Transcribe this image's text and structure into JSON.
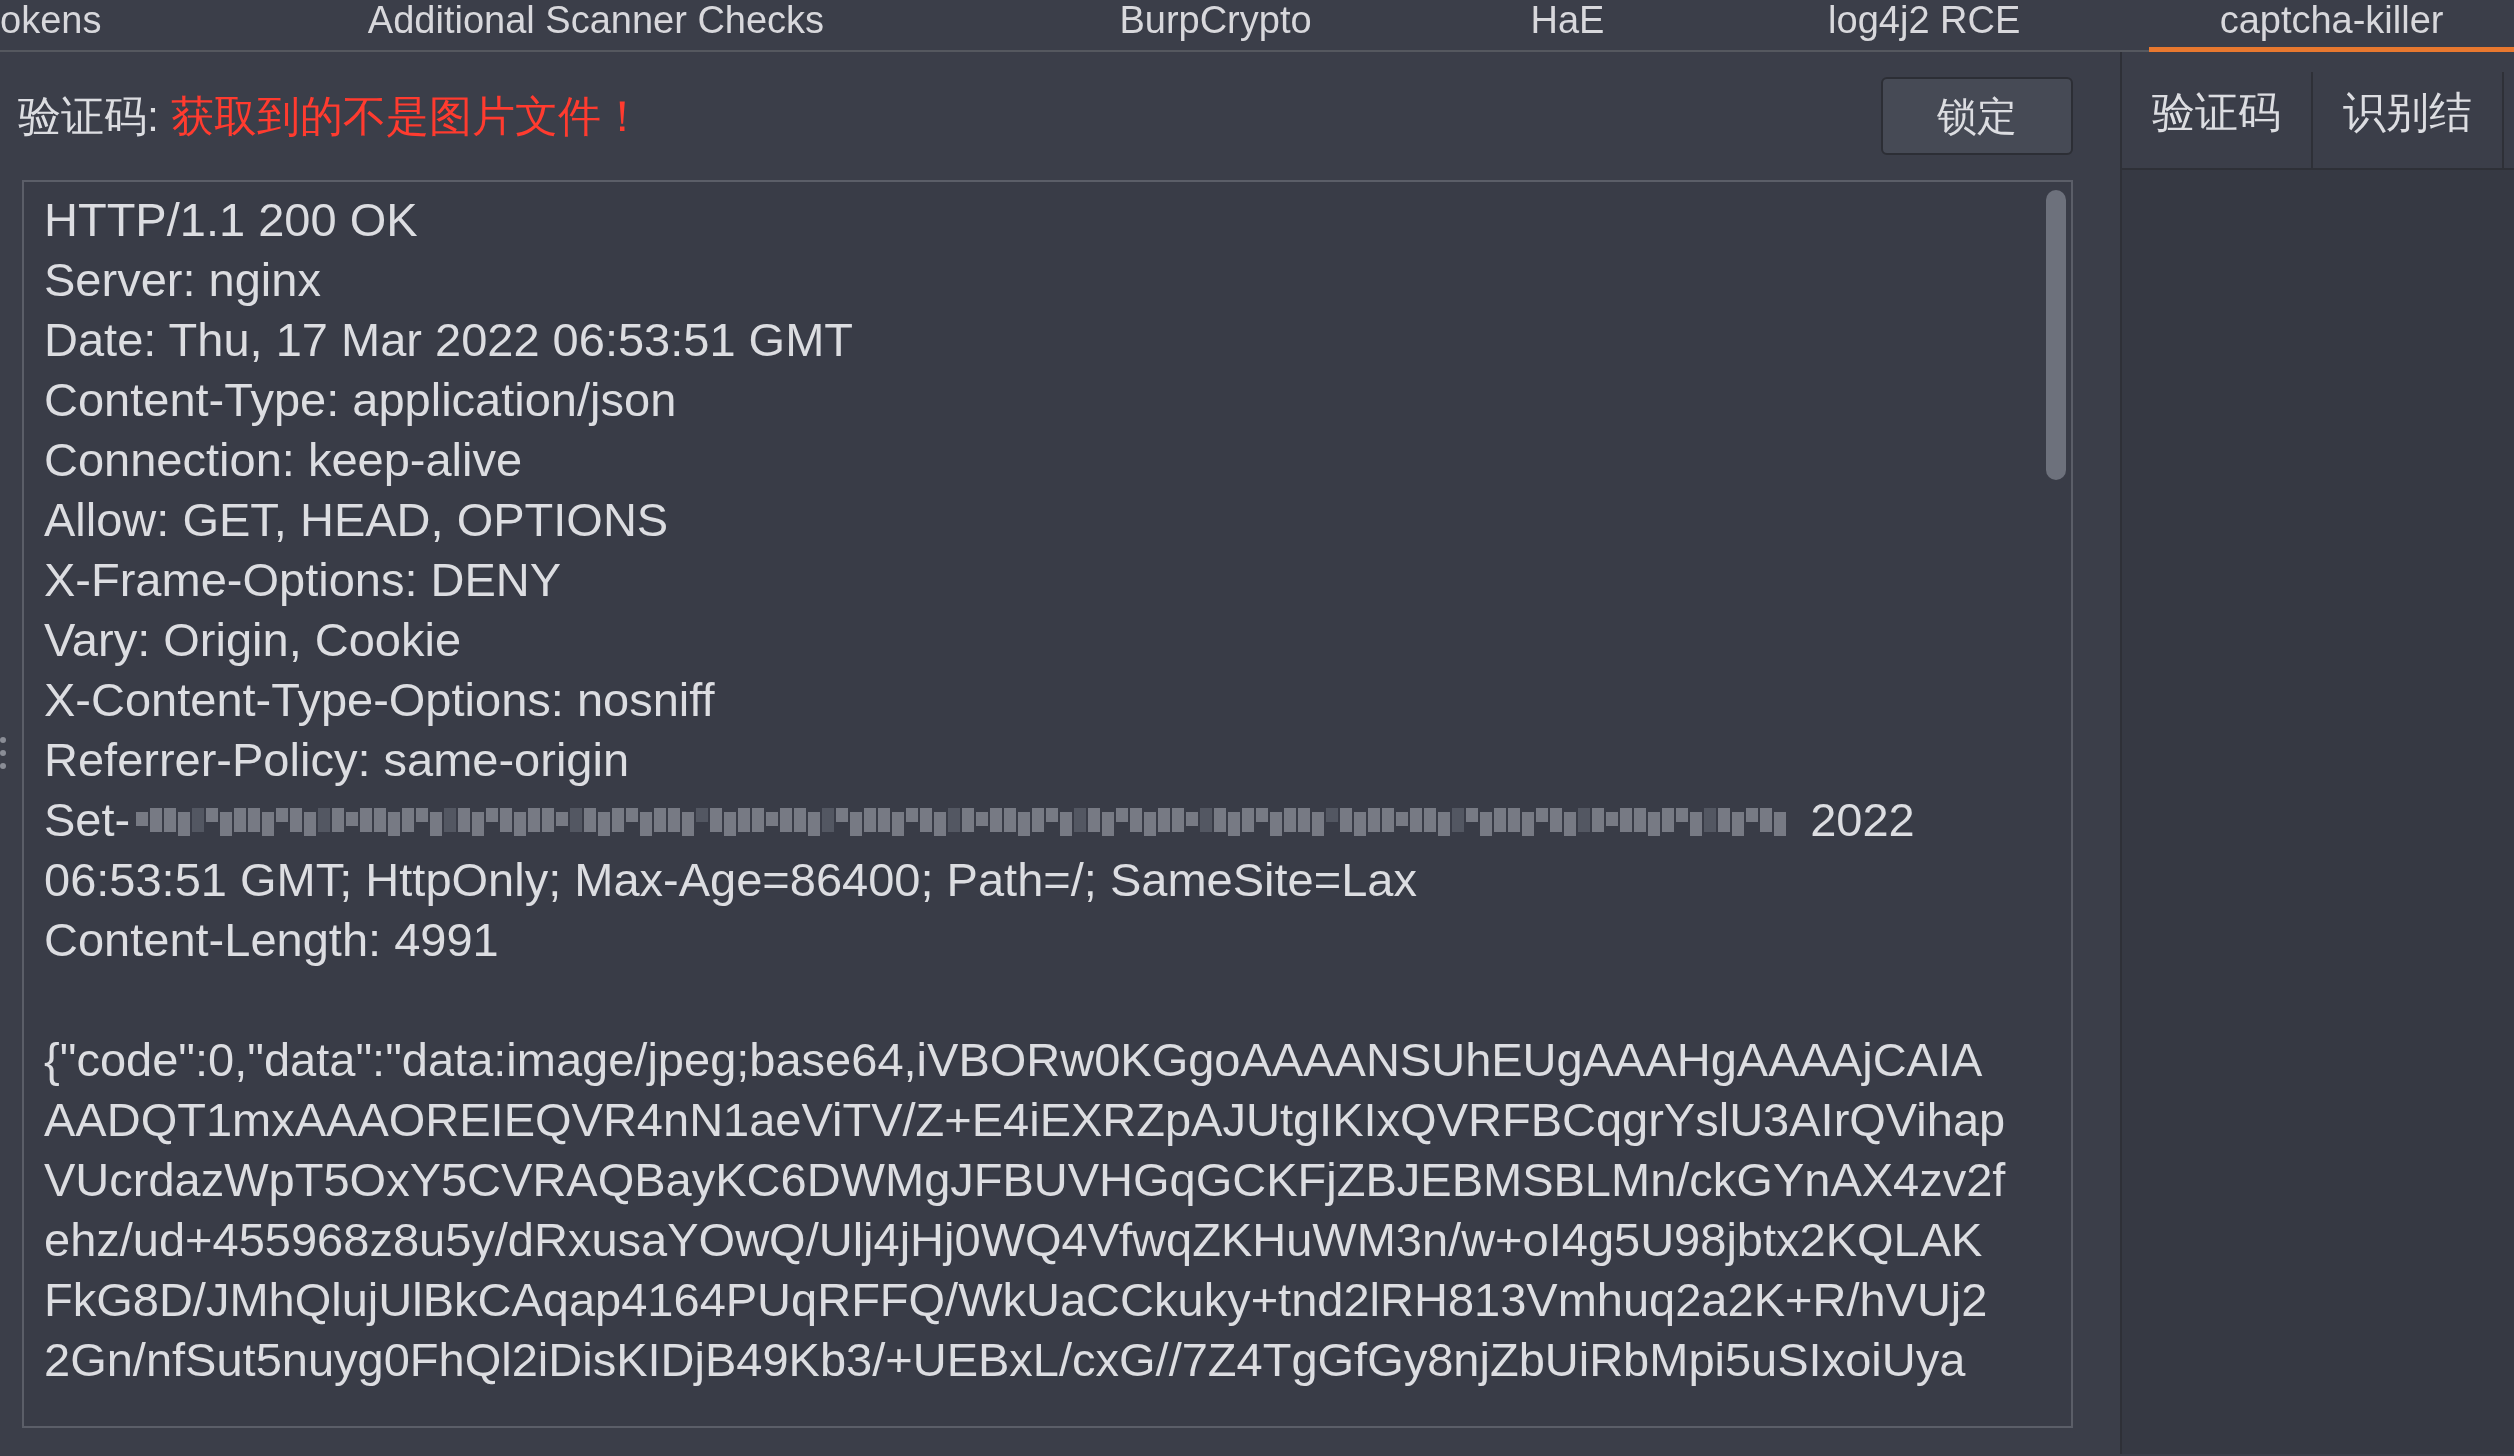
{
  "tabs": [
    {
      "label": "okens",
      "selected": false
    },
    {
      "label": "Additional Scanner Checks",
      "selected": false
    },
    {
      "label": "BurpCrypto",
      "selected": false
    },
    {
      "label": "HaE",
      "selected": false
    },
    {
      "label": "log4j2 RCE",
      "selected": false
    },
    {
      "label": "captcha-killer",
      "selected": true
    }
  ],
  "captcha": {
    "label": "验证码:",
    "message": "获取到的不是图片文件！",
    "lock_button": "锁定"
  },
  "response": {
    "lines": [
      {
        "kind": "text",
        "text": "HTTP/1.1 200 OK"
      },
      {
        "kind": "text",
        "text": "Server: nginx"
      },
      {
        "kind": "text",
        "text": "Date: Thu, 17 Mar 2022 06:53:51 GMT"
      },
      {
        "kind": "text",
        "text": "Content-Type: application/json"
      },
      {
        "kind": "text",
        "text": "Connection: keep-alive"
      },
      {
        "kind": "text",
        "text": "Allow: GET, HEAD, OPTIONS"
      },
      {
        "kind": "text",
        "text": "X-Frame-Options: DENY"
      },
      {
        "kind": "text",
        "text": "Vary: Origin, Cookie"
      },
      {
        "kind": "text",
        "text": "X-Content-Type-Options: nosniff"
      },
      {
        "kind": "text",
        "text": "Referrer-Policy: same-origin"
      },
      {
        "kind": "redacted",
        "before": "Set-",
        "after": "2022"
      },
      {
        "kind": "text",
        "text": "06:53:51 GMT; HttpOnly; Max-Age=86400; Path=/; SameSite=Lax"
      },
      {
        "kind": "text",
        "text": "Content-Length: 4991"
      },
      {
        "kind": "blank"
      },
      {
        "kind": "text",
        "text": "{\"code\":0,\"data\":\"data:image/jpeg;base64,iVBORw0KGgoAAAANSUhEUgAAAHgAAAAjCAIA"
      },
      {
        "kind": "text",
        "text": "AADQT1mxAAAOREIEQVR4nN1aeViTV/Z+E4iEXRZpAJUtgIKIxQVRFBCqgrYslU3AIrQVihap"
      },
      {
        "kind": "text",
        "text": "VUcrdazWpT5OxY5CVRAQBayKC6DWMgJFBUVHGqGCKFjZBJEBMSBLMn/ckGYnAX4zv2f"
      },
      {
        "kind": "text",
        "text": "ehz/ud+455968z8u5y/dRxusaYOwQ/Ulj4jHj0WQ4VfwqZKHuWM3n/w+oI4g5U98jbtx2KQLAK"
      },
      {
        "kind": "text",
        "text": "FkG8D/JMhQlujUlBkCAqap4164PUqRFFQ/WkUaCCkuky+tnd2lRH813Vmhuq2a2K+R/hVUj2"
      },
      {
        "kind": "text",
        "text": "2Gn/nfSut5nuyg0FhQl2iDisKIDjB49Kb3/+UEBxL/cxG//7Z4TgGfGy8njZbUiRbMpi5uSIxoiUya"
      }
    ]
  },
  "side_tabs": [
    {
      "label": "验证码"
    },
    {
      "label": "识别结"
    }
  ]
}
